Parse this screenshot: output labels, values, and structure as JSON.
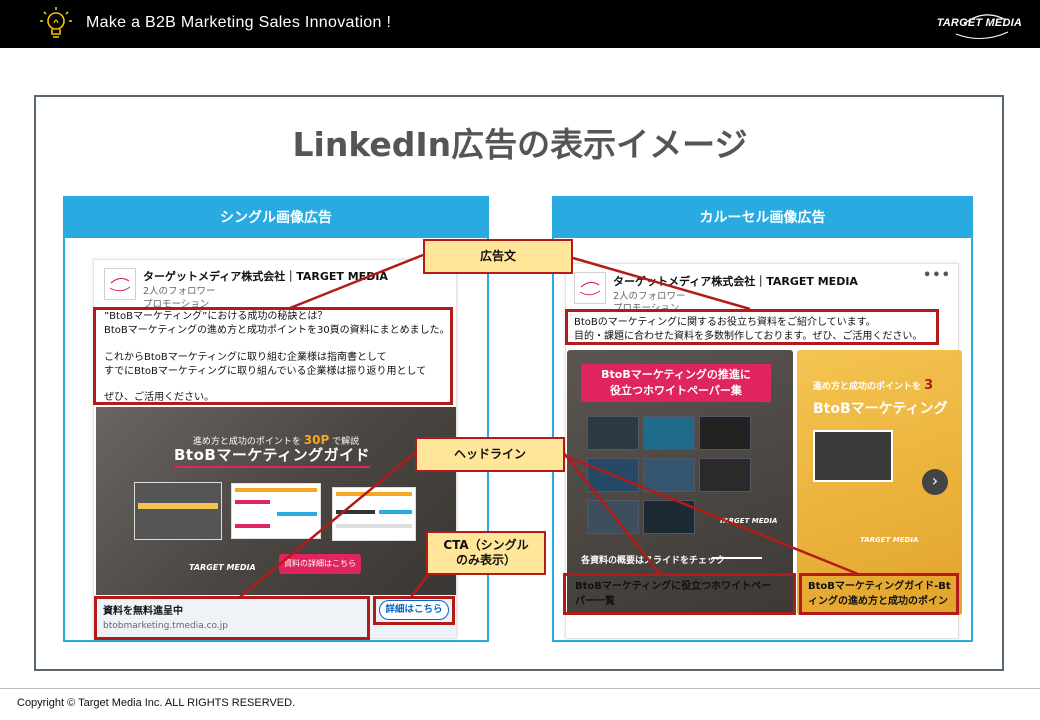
{
  "header": {
    "tagline": "Make a B2B Marketing Sales Innovation !",
    "logo_text": "TARGET MEDIA"
  },
  "title": "LinkedIn広告の表示イメージ",
  "single": {
    "panel_title": "シングル画像広告",
    "company": "ターゲットメディア株式会社｜TARGET MEDIA",
    "followers": "2人のフォロワー",
    "promo": "プロモーション",
    "body_lines": [
      "”BtoBマーケティング”における成功の秘訣とは？",
      "BtoBマーケティングの進め方と成功ポイントを30頁の資料にまとめました。",
      "",
      "これからBtoBマーケティングに取り組む企業様は指南書として",
      "すでにBtoBマーケティングに取り組んでいる企業様は振り返り用として",
      "",
      "ぜひ、ご活用ください。"
    ],
    "creative_sub_a": "進め方と成功のポイントを",
    "creative_sub_b": "30P",
    "creative_sub_c": "で解説",
    "creative_headline": "BtoBマーケティングガイド",
    "creative_cta": "資料の詳細はこちら",
    "creative_brand": "TARGET MEDIA",
    "link_title": "資料を無料進呈中",
    "link_url": "btobmarketing.tmedia.co.jp",
    "cta_button": "詳細はこちら"
  },
  "carousel": {
    "panel_title": "カルーセル画像広告",
    "company": "ターゲットメディア株式会社｜TARGET MEDIA",
    "followers": "2人のフォロワー",
    "promo": "プロモーション",
    "more": "•••",
    "body_lines": [
      "BtoBのマーケティングに関するお役立ち資料をご紹介しています。",
      "目的・課題に合わせた資料を多数制作しております。ぜひ、ご活用ください。"
    ],
    "slide1_title_a": "BtoBマーケティングの推進に",
    "slide1_title_b": "役立つホワイトペーパー集",
    "slide1_foot": "各資料の概要はスライドをチェック",
    "slide1_brand": "TARGET MEDIA",
    "slide1_caption_a": "BtoBマーケティングに役立つホワイトペー",
    "slide1_caption_b": "パー一覧",
    "slide2_sub_a": "進め方と成功のポイントを",
    "slide2_sub_b": "3",
    "slide2_headline": "BtoBマーケティング",
    "slide2_brand": "TARGET MEDIA",
    "slide2_caption_a": "BtoBマーケティングガイド-Bt",
    "slide2_caption_b": "ィングの進め方と成功のポイン",
    "next": "›"
  },
  "callouts": {
    "ad_text": "広告文",
    "headline": "ヘッドライン",
    "cta_a": "CTA（シングル",
    "cta_b": "のみ表示）"
  },
  "footer": {
    "copyright": "Copyright © Target Media Inc. ALL RIGHTS RESERVED."
  },
  "colors": {
    "accent_blue": "#29abe2",
    "callout_fill": "#ffe699",
    "callout_border": "#b31b1b",
    "brand_pink": "#e0245e"
  }
}
